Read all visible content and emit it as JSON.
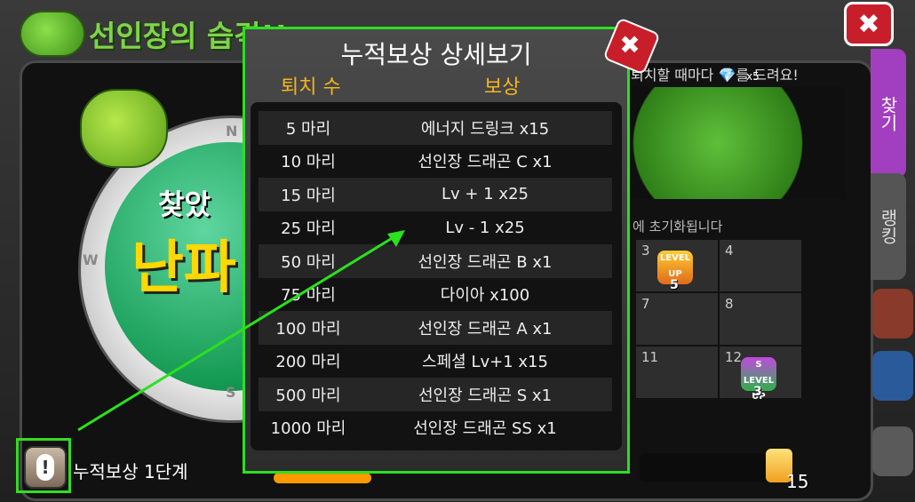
{
  "window": {
    "title": "선인장의 습격!!",
    "close_label": "✖"
  },
  "radar": {
    "found_text": "찾았",
    "big_text": "난파",
    "compass": {
      "n": "N",
      "w": "W",
      "s": "S"
    }
  },
  "right_panel": {
    "banner": "퇴치할 때마다 💎를 드려요!",
    "gem_count": "x5",
    "reset_text": "에 초기화됩니다",
    "grid_cells": [
      {
        "num": "3",
        "levelup": "LEVEL UP",
        "count": "5"
      },
      {
        "num": "4"
      },
      {
        "num": "7"
      },
      {
        "num": "8"
      },
      {
        "num": "11"
      },
      {
        "num": "12",
        "levelup": "LEVEL UP",
        "count": "3",
        "badge": "S"
      }
    ]
  },
  "tabs": {
    "find": "찾기",
    "rank": "랭킹"
  },
  "bottom": {
    "label": "누적보상 1단계",
    "alert_symbol": "!",
    "drink_count": "15"
  },
  "popup": {
    "title": "누적보상 상세보기",
    "close_label": "✖",
    "col_kills": "퇴치 수",
    "col_reward": "보상",
    "rows": [
      {
        "kills": "5 마리",
        "reward": "에너지 드링크 x15"
      },
      {
        "kills": "10 마리",
        "reward": "선인장 드래곤 C x1"
      },
      {
        "kills": "15 마리",
        "reward": "Lv + 1 x25"
      },
      {
        "kills": "25 마리",
        "reward": "Lv - 1 x25"
      },
      {
        "kills": "50 마리",
        "reward": "선인장 드래곤 B x1"
      },
      {
        "kills": "75 마리",
        "reward": "다이아 x100"
      },
      {
        "kills": "100 마리",
        "reward": "선인장 드래곤 A x1"
      },
      {
        "kills": "200 마리",
        "reward": "스페셜 Lv+1 x15"
      },
      {
        "kills": "500 마리",
        "reward": "선인장 드래곤 S x1"
      },
      {
        "kills": "1000 마리",
        "reward": "선인장 드래곤 SS x1"
      }
    ]
  },
  "colors": {
    "highlight": "#2be01f",
    "accent_gold": "#f5b51c",
    "tab_purple": "#a23ec0"
  }
}
